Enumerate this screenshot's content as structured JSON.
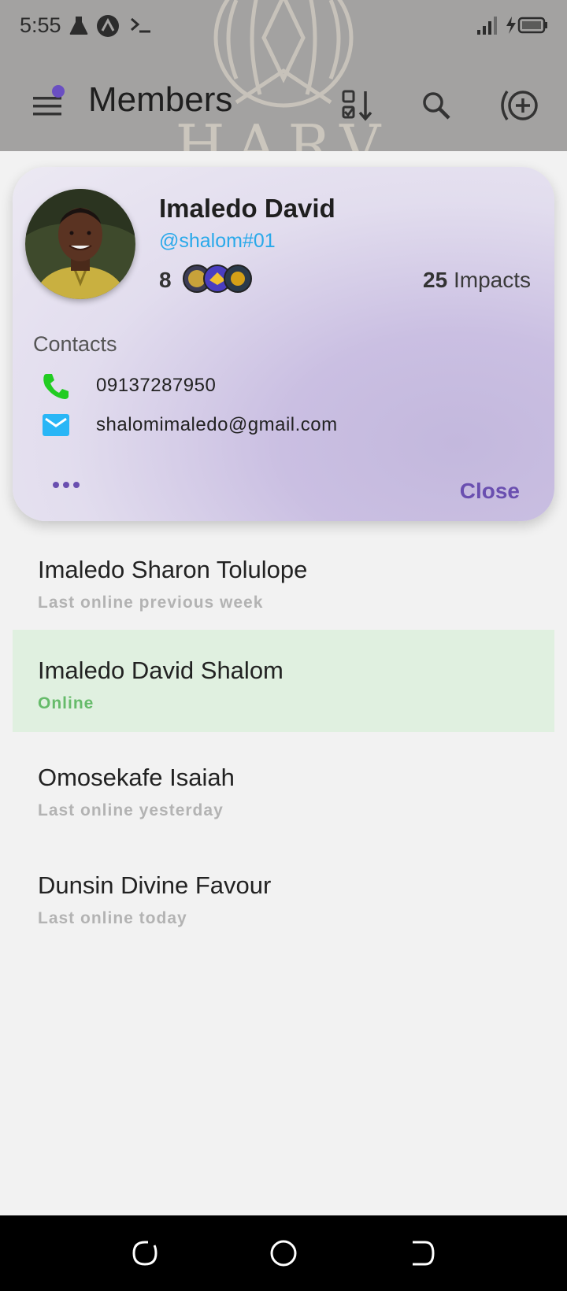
{
  "status_bar": {
    "time": "5:55"
  },
  "app_bar": {
    "title": "Members"
  },
  "watermark": {
    "text": "HARV"
  },
  "profile_card": {
    "name": "Imaledo David",
    "handle": "@shalom#01",
    "badge_count": "8",
    "impacts_count": "25",
    "impacts_label": "Impacts",
    "contacts_label": "Contacts",
    "phone": "09137287950",
    "email": "shalomimaledo@gmail.com",
    "close_label": "Close"
  },
  "members": [
    {
      "name": "Imaledo Sharon Tolulope",
      "status": "Last online previous week",
      "online": false
    },
    {
      "name": "Imaledo David Shalom",
      "status": "Online",
      "online": true
    },
    {
      "name": "Omosekafe Isaiah",
      "status": "Last online yesterday",
      "online": false
    },
    {
      "name": "Dunsin Divine Favour",
      "status": "Last online today",
      "online": false
    }
  ],
  "colors": {
    "accent": "#6a4fb0",
    "handle": "#29a9ea",
    "online_bg": "#e0f0e0",
    "online_text": "#66bb6a",
    "phone_icon": "#22cc22",
    "mail_icon": "#29b6f6"
  },
  "icons": {
    "menu": "hamburger-menu-icon",
    "sort": "sort-checklist-icon",
    "search": "search-icon",
    "add": "add-circle-icon",
    "phone": "phone-icon",
    "email": "email-icon",
    "more": "more-horizontal-icon"
  }
}
